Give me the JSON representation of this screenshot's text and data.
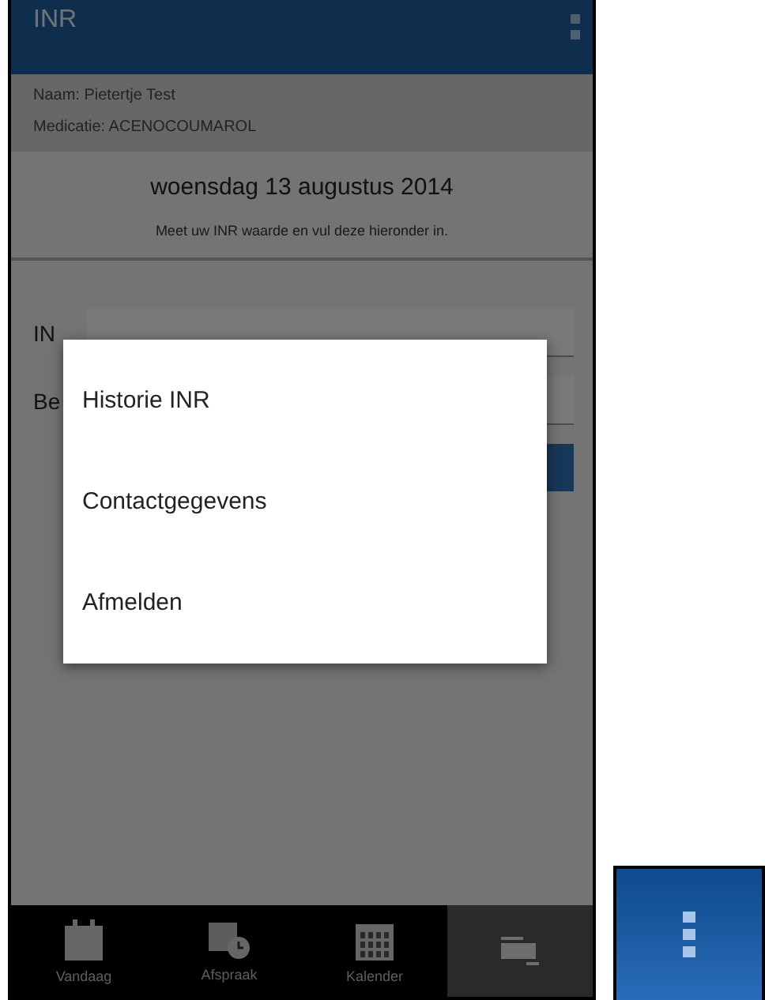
{
  "app_bar": {
    "title": "INR"
  },
  "patient": {
    "name": "Naam: Pietertje Test",
    "medication": "Medicatie: ACENOCOUMAROL"
  },
  "date": "woensdag 13 augustus 2014",
  "instruction": "Meet uw INR waarde en vul deze hieronder in.",
  "form": {
    "fields": [
      {
        "label": "IN"
      },
      {
        "label": "Be"
      }
    ]
  },
  "menu": {
    "items": [
      {
        "label": "Historie INR"
      },
      {
        "label": "Contactgegevens"
      },
      {
        "label": "Afmelden"
      }
    ]
  },
  "tabs": [
    {
      "label": "Vandaag",
      "selected": false
    },
    {
      "label": "Afspraak",
      "selected": false
    },
    {
      "label": "Kalender",
      "selected": false
    },
    {
      "selected": true
    }
  ]
}
